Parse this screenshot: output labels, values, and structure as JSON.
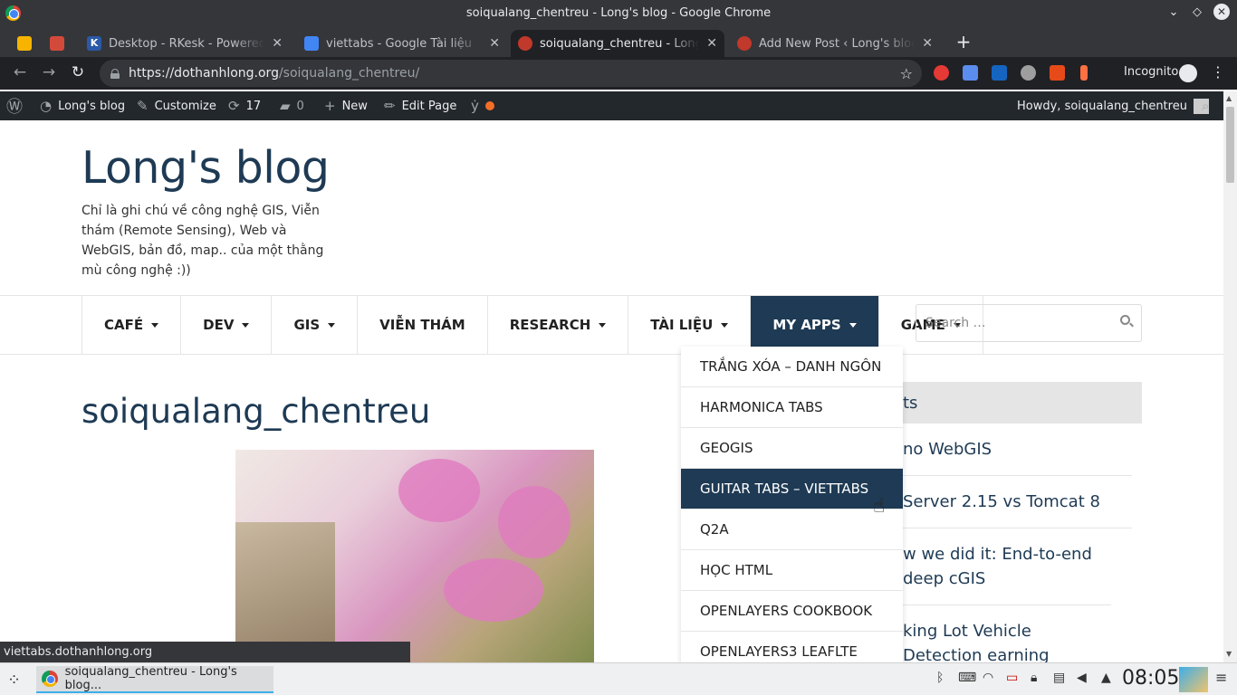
{
  "window": {
    "title": "soiqualang_chentreu - Long's blog - Google Chrome"
  },
  "tabs": [
    {
      "label": "Desktop - RKesk - Powered by",
      "icon_color": "#2a5aa8"
    },
    {
      "label": "viettabs - Google Tài liệu",
      "icon_color": "#4285f4"
    },
    {
      "label": "soiqualang_chentreu - Long's",
      "icon_color": "#c0392b"
    },
    {
      "label": "Add New Post ‹ Long's blog —",
      "icon_color": "#c0392b"
    }
  ],
  "toolbar": {
    "url_domain": "https://dothanhlong.org",
    "url_path": "/soiqualang_chentreu/",
    "incognito_label": "Incognito"
  },
  "adminbar": {
    "site_label": "Long's blog",
    "customize_label": "Customize",
    "updates_count": "17",
    "comments_count": "0",
    "new_label": "New",
    "edit_label": "Edit Page",
    "howdy_label": "Howdy, soiqualang_chentreu"
  },
  "site": {
    "title": "Long's blog",
    "description": "Chỉ là ghi chú về công nghệ GIS, Viễn thám (Remote Sensing), Web và WebGIS, bản đồ, map.. của một thằng mù công nghệ :))"
  },
  "nav": [
    {
      "label": "CAFÉ",
      "has_sub": true
    },
    {
      "label": "DEV",
      "has_sub": true
    },
    {
      "label": "GIS",
      "has_sub": true
    },
    {
      "label": "VIỄN THÁM",
      "has_sub": false
    },
    {
      "label": "RESEARCH",
      "has_sub": true
    },
    {
      "label": "TÀI LIỆU",
      "has_sub": true
    },
    {
      "label": "MY APPS",
      "has_sub": true
    },
    {
      "label": "GAME",
      "has_sub": true
    }
  ],
  "search": {
    "placeholder": "Search …"
  },
  "dropdown": [
    "TRẮNG XÓA – DANH NGÔN",
    "HARMONICA TABS",
    "GEOGIS",
    "GUITAR TABS – VIETTABS",
    "Q2A",
    "HỌC HTML",
    "OPENLAYERS COOKBOOK",
    "OPENLAYERS3 LEAFLTE"
  ],
  "entry": {
    "title": "soiqualang_chentreu"
  },
  "widget": {
    "heading": "ts",
    "items": [
      "no WebGIS",
      "Server 2.15 vs Tomcat 8",
      "w we did it: End-to-end deep cGIS",
      "king Lot Vehicle Detection earning"
    ]
  },
  "status_tip": "viettabs.dothanhlong.org",
  "taskbar": {
    "app_label": "soiqualang_chentreu - Long's blog...",
    "clock": "08:05"
  },
  "colors": {
    "brand_navy": "#1e3a54",
    "admin_bar": "#23282d",
    "chrome_dark": "#35363a"
  }
}
